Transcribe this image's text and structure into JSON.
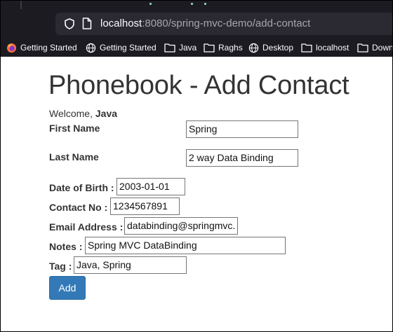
{
  "browser": {
    "url_host": "localhost",
    "url_rest": ":8080/spring-mvc-demo/add-contact",
    "bookmarks": [
      {
        "icon": "firefox-icon",
        "label": "Getting Started"
      },
      {
        "icon": "globe-icon",
        "label": "Getting Started"
      },
      {
        "icon": "folder-icon",
        "label": "Java"
      },
      {
        "icon": "folder-icon",
        "label": "Raghs"
      },
      {
        "icon": "globe-icon",
        "label": "Desktop"
      },
      {
        "icon": "folder-icon",
        "label": "localhost"
      },
      {
        "icon": "folder-icon",
        "label": "Downl"
      }
    ]
  },
  "page": {
    "title": "Phonebook - Add Contact",
    "welcome_prefix": "Welcome,",
    "welcome_user": "Java",
    "form": {
      "first_name_label": "First Name",
      "first_name_value": "Spring",
      "last_name_label": "Last Name",
      "last_name_value": "2 way Data Binding",
      "dob_label": "Date of Birth :",
      "dob_value": "2003-01-01",
      "contact_label": "Contact No :",
      "contact_value": "1234567891",
      "email_label": "Email Address :",
      "email_value": "databinding@springmvc.",
      "notes_label": "Notes :",
      "notes_value": "Spring MVC DataBinding",
      "tag_label": "Tag :",
      "tag_value": "Java, Spring",
      "submit_label": "Add"
    }
  }
}
